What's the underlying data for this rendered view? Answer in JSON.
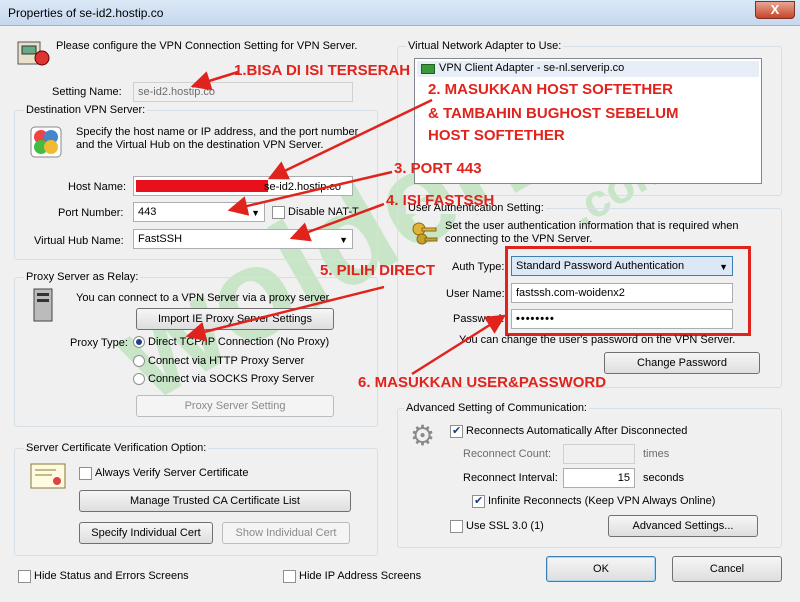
{
  "window": {
    "title": "Properties of se-id2.hostip.co",
    "close_glyph": "X"
  },
  "intro": "Please configure the VPN Connection Setting for VPN Server.",
  "setting_name": {
    "label": "Setting Name:",
    "value": "se-id2.hostip.co"
  },
  "destination": {
    "group_title": "Destination VPN Server:",
    "desc": "Specify the host name or IP address, and the port number and the Virtual Hub on the destination VPN Server.",
    "host_label": "Host Name:",
    "host_value": "se-id2.hostip.co",
    "port_label": "Port Number:",
    "port_value": "443",
    "disable_nat_label": "Disable NAT-T",
    "hub_label": "Virtual Hub Name:",
    "hub_value": "FastSSH"
  },
  "proxy": {
    "group_title": "Proxy Server as Relay:",
    "desc": "You can connect to a VPN Server via a proxy server.",
    "import_button": "Import IE Proxy Server Settings",
    "type_label": "Proxy Type:",
    "options": [
      "Direct TCP/IP Connection (No Proxy)",
      "Connect via HTTP Proxy Server",
      "Connect via SOCKS Proxy Server"
    ],
    "setting_button": "Proxy Server Setting"
  },
  "cert": {
    "group_title": "Server Certificate Verification Option:",
    "always_verify": "Always Verify Server Certificate",
    "manage_button": "Manage Trusted CA Certificate List",
    "specify_button": "Specify Individual Cert",
    "show_button": "Show Individual Cert"
  },
  "bottom_checks": {
    "hide_status": "Hide Status and Errors Screens",
    "hide_ip": "Hide IP Address Screens"
  },
  "adapter": {
    "group_title": "Virtual Network Adapter to Use:",
    "item": "VPN Client Adapter - se-nl.serverip.co"
  },
  "auth": {
    "group_title": "User Authentication Setting:",
    "desc": "Set the user authentication information that is required when connecting to the VPN Server.",
    "type_label": "Auth Type:",
    "type_value": "Standard Password Authentication",
    "user_label": "User Name:",
    "user_value": "fastssh.com-woidenx2",
    "pass_label": "Password:",
    "pass_value": "••••••••",
    "change_desc": "You can change the user's password on the VPN Server.",
    "change_button": "Change Password"
  },
  "advanced": {
    "group_title": "Advanced Setting of Communication:",
    "reconnect_label": "Reconnects Automatically After Disconnected",
    "count_label": "Reconnect Count:",
    "count_unit": "times",
    "interval_label": "Reconnect Interval:",
    "interval_value": "15",
    "interval_unit": "seconds",
    "infinite_label": "Infinite Reconnects (Keep VPN Always Online)",
    "ssl_label": "Use SSL 3.0 (1)",
    "advanced_button": "Advanced Settings..."
  },
  "footer": {
    "ok": "OK",
    "cancel": "Cancel"
  },
  "annotations": {
    "a1": "1.BISA DI ISI TERSERAH",
    "a2_1": "2. MASUKKAN HOST SOFTETHER",
    "a2_2": "& TAMBAHIN BUGHOST SEBELUM",
    "a2_3": "HOST SOFTETHER",
    "a3": "3. PORT 443",
    "a4": "4. ISI FASTSSH",
    "a5": "5. PILIH DIRECT",
    "a6": "6. MASUKKAN USER&PASSWORD"
  },
  "watermark": {
    "main": "woidenx",
    "suffix": ".com"
  },
  "colors": {
    "annotation_red": "#e0231c",
    "watermark_green": "#3cbe3c",
    "focus_blue": "#3c7fb1"
  }
}
